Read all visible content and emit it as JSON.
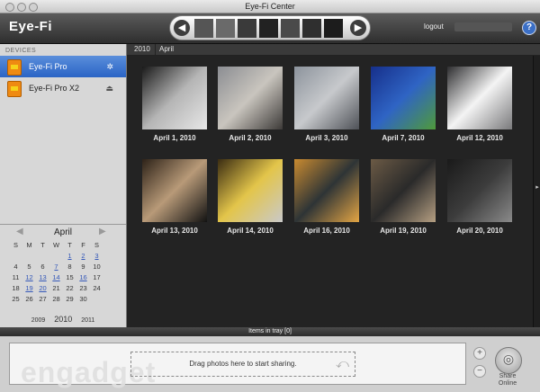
{
  "window": {
    "title": "Eye-Fi Center"
  },
  "toolbar": {
    "logo": "Eye-Fi",
    "logout": "logout",
    "help": "?"
  },
  "sidebar": {
    "devices_header": "DEVICES",
    "devices": [
      {
        "name": "Eye-Fi Pro",
        "action_icon": "gear-icon",
        "action": "✲"
      },
      {
        "name": "Eye-Fi Pro X2",
        "action_icon": "eject-icon",
        "action": "⏏"
      }
    ]
  },
  "calendar": {
    "month": "April",
    "weekdays": [
      "S",
      "M",
      "T",
      "W",
      "T",
      "F",
      "S"
    ],
    "weeks": [
      [
        "",
        "",
        "",
        "",
        "1",
        "2",
        "3"
      ],
      [
        "4",
        "5",
        "6",
        "7",
        "8",
        "9",
        "10"
      ],
      [
        "11",
        "12",
        "13",
        "14",
        "15",
        "16",
        "17"
      ],
      [
        "18",
        "19",
        "20",
        "21",
        "22",
        "23",
        "24"
      ],
      [
        "25",
        "26",
        "27",
        "28",
        "29",
        "30",
        ""
      ]
    ],
    "photo_days": [
      "1",
      "2",
      "3",
      "7",
      "12",
      "13",
      "14",
      "16",
      "19",
      "20"
    ],
    "years": {
      "prev": "2009",
      "current": "2010",
      "next": "2011"
    }
  },
  "breadcrumb": [
    "2010",
    "April"
  ],
  "photos": [
    {
      "caption": "April 1, 2010",
      "colors": [
        "#1a1a1a",
        "#b5b5b5",
        "#e7e7e7"
      ]
    },
    {
      "caption": "April 2, 2010",
      "colors": [
        "#8b8d92",
        "#c9c5be",
        "#3d3a38"
      ]
    },
    {
      "caption": "April 3, 2010",
      "colors": [
        "#8c939c",
        "#c7c9cc",
        "#4e5157"
      ]
    },
    {
      "caption": "April 7, 2010",
      "colors": [
        "#162f8a",
        "#2f64c4",
        "#4f9a3a"
      ]
    },
    {
      "caption": "April 12, 2010",
      "colors": [
        "#2d2d2f",
        "#f4f4f4",
        "#7a7a7c"
      ]
    },
    {
      "caption": "April 13, 2010",
      "colors": [
        "#2d2218",
        "#b89a78",
        "#121212"
      ]
    },
    {
      "caption": "April 14, 2010",
      "colors": [
        "#3a2c12",
        "#e3c54a",
        "#c9c9c9"
      ]
    },
    {
      "caption": "April 16, 2010",
      "colors": [
        "#c98a30",
        "#2e3436",
        "#e3a544"
      ]
    },
    {
      "caption": "April 19, 2010",
      "colors": [
        "#6b5a45",
        "#2a2a2a",
        "#b59f82"
      ]
    },
    {
      "caption": "April 20, 2010",
      "colors": [
        "#1a1a1a",
        "#3c3c3c",
        "#8a8a8a"
      ]
    }
  ],
  "tray": {
    "header": "Items in tray [0]",
    "drop_text": "Drag photos here to start sharing.",
    "watermark": "engadget",
    "add": "+",
    "remove": "−",
    "share_label_1": "Share",
    "share_label_2": "Online"
  },
  "colors": {
    "accent": "#2a64c5",
    "logo_dot": "#f7931e",
    "link": "#3558b8"
  }
}
